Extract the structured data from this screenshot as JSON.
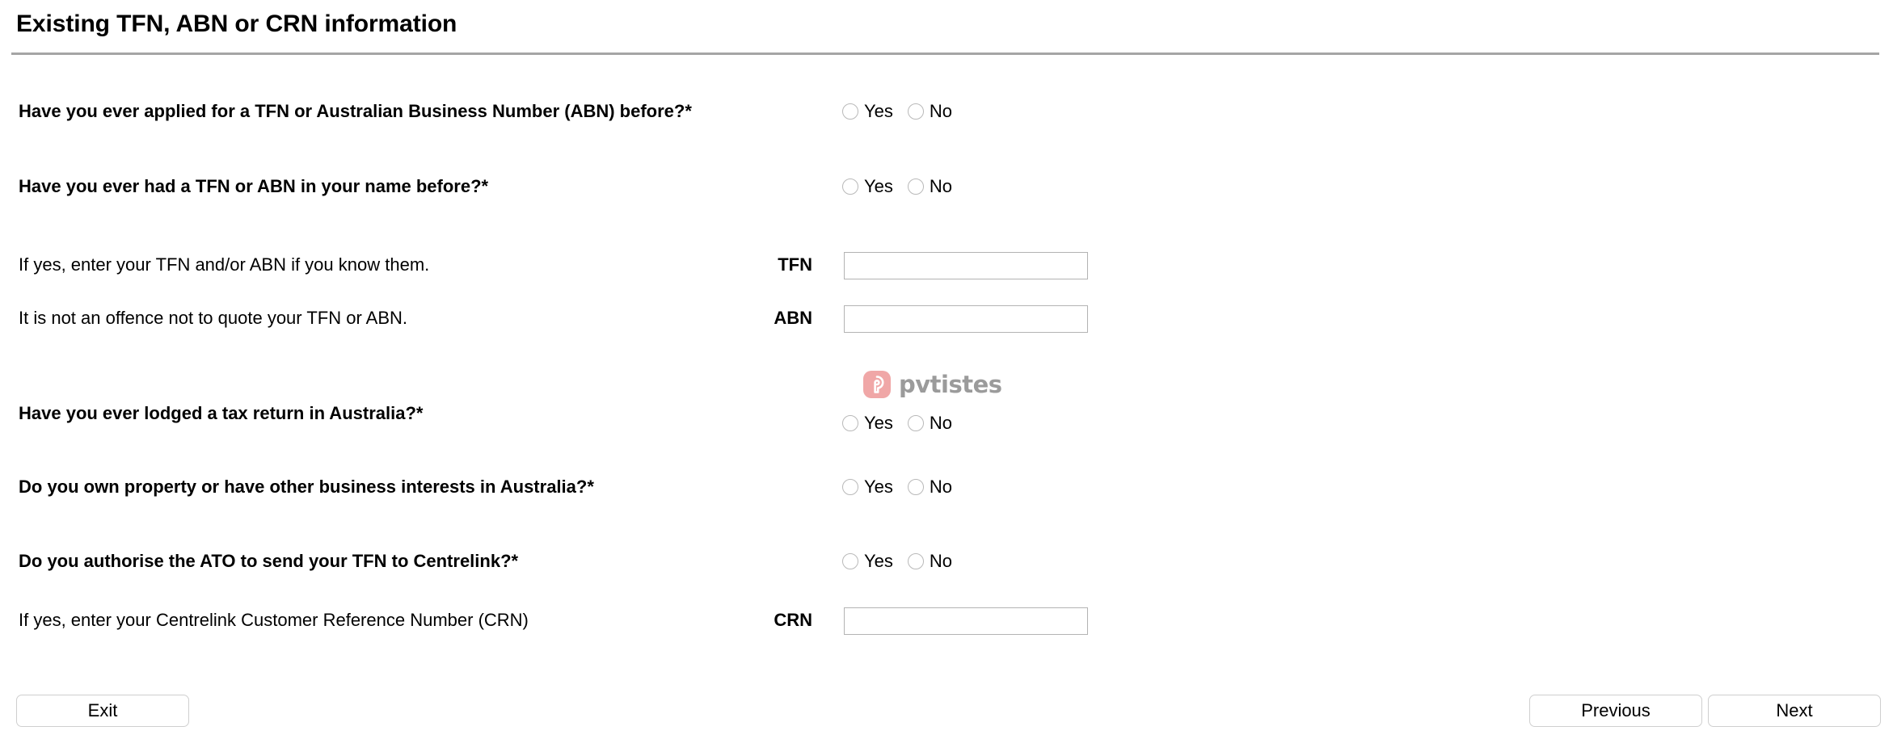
{
  "header": {
    "title": "Existing TFN, ABN or CRN information"
  },
  "radio_options": {
    "yes": "Yes",
    "no": "No"
  },
  "rows": [
    {
      "id": "applied-tfn-abn",
      "label": "Have you ever applied for a TFN or Australian Business Number (ABN) before?*",
      "type": "radio"
    },
    {
      "id": "had-tfn-abn",
      "label": "Have you ever had a TFN or ABN in your name before?*",
      "type": "radio"
    },
    {
      "id": "tfn-entry",
      "label": "If yes, enter your TFN and/or ABN if you know them.",
      "field_label": "TFN",
      "type": "input",
      "value": ""
    },
    {
      "id": "abn-entry",
      "label": "It is not an offence not to quote your TFN or ABN.",
      "field_label": "ABN",
      "type": "input",
      "value": ""
    },
    {
      "id": "lodged-tax-return",
      "label": "Have you ever lodged a tax return in Australia?*",
      "type": "radio"
    },
    {
      "id": "own-property",
      "label": "Do you own property or have other business interests in Australia?*",
      "type": "radio"
    },
    {
      "id": "authorise-ato",
      "label": "Do you authorise the ATO to send your TFN to Centrelink?*",
      "type": "radio"
    },
    {
      "id": "crn-entry",
      "label": "If yes, enter your Centrelink Customer Reference Number (CRN)",
      "field_label": "CRN",
      "type": "input",
      "value": ""
    }
  ],
  "watermark": {
    "text": "pvtistes",
    "icon": "pvtistes-logo-icon",
    "mark_color": "#f0a7a7",
    "text_color": "#9b9b9b"
  },
  "footer": {
    "exit_label": "Exit",
    "previous_label": "Previous",
    "next_label": "Next"
  },
  "colors": {
    "rule": "#a5a5a5",
    "input_border": "#b3b3b3",
    "radio_border": "#b9b9b9",
    "button_border": "#cfcfcf",
    "text": "#000000"
  }
}
